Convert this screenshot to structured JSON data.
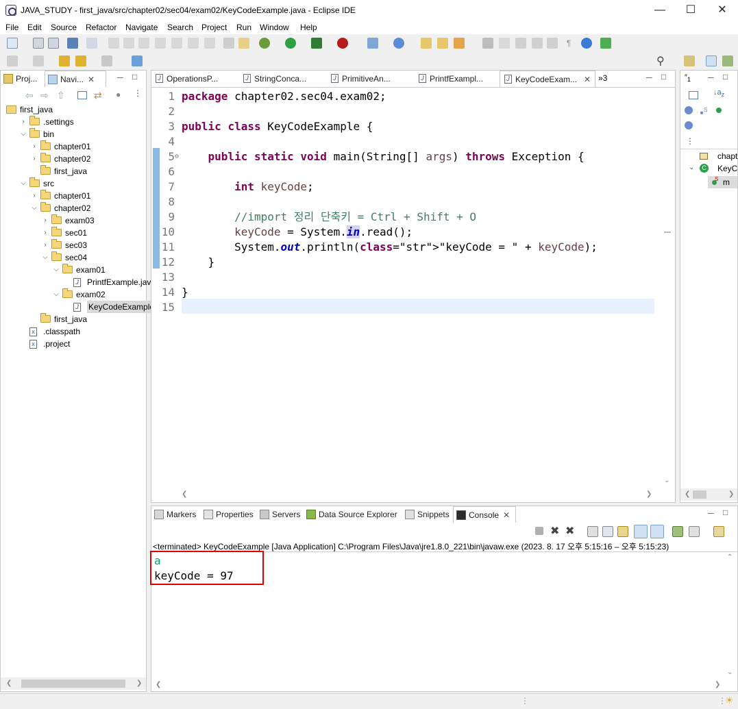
{
  "window": {
    "title": "JAVA_STUDY - first_java/src/chapter02/sec04/exam02/KeyCodeExample.java - Eclipse IDE"
  },
  "menu": [
    "File",
    "Edit",
    "Source",
    "Refactor",
    "Navigate",
    "Search",
    "Project",
    "Run",
    "Window",
    "Help"
  ],
  "left_tabs": [
    "Proj...",
    "Navi..."
  ],
  "tree": [
    {
      "label": "first_java",
      "depth": 0,
      "type": "project",
      "open": true
    },
    {
      "label": ".settings",
      "depth": 1,
      "type": "folder",
      "open": false
    },
    {
      "label": "bin",
      "depth": 1,
      "type": "folder",
      "open": true
    },
    {
      "label": "chapter01",
      "depth": 2,
      "type": "folder",
      "open": false
    },
    {
      "label": "chapter02",
      "depth": 2,
      "type": "folder",
      "open": false
    },
    {
      "label": "first_java",
      "depth": 2,
      "type": "folder",
      "open": null
    },
    {
      "label": "src",
      "depth": 1,
      "type": "folder",
      "open": true
    },
    {
      "label": "chapter01",
      "depth": 2,
      "type": "folder",
      "open": false
    },
    {
      "label": "chapter02",
      "depth": 2,
      "type": "folder",
      "open": true
    },
    {
      "label": "exam03",
      "depth": 3,
      "type": "folder",
      "open": false
    },
    {
      "label": "sec01",
      "depth": 3,
      "type": "folder",
      "open": false
    },
    {
      "label": "sec03",
      "depth": 3,
      "type": "folder",
      "open": false
    },
    {
      "label": "sec04",
      "depth": 3,
      "type": "folder",
      "open": true
    },
    {
      "label": "exam01",
      "depth": 4,
      "type": "folder",
      "open": true
    },
    {
      "label": "PrintfExample.java",
      "depth": 5,
      "type": "java",
      "open": null
    },
    {
      "label": "exam02",
      "depth": 4,
      "type": "folder",
      "open": true
    },
    {
      "label": "KeyCodeExample.java",
      "depth": 5,
      "type": "java",
      "open": null,
      "selected": true
    },
    {
      "label": "first_java",
      "depth": 2,
      "type": "folder",
      "open": null
    },
    {
      "label": ".classpath",
      "depth": 1,
      "type": "xml",
      "open": null
    },
    {
      "label": ".project",
      "depth": 1,
      "type": "xml",
      "open": null
    }
  ],
  "editor_tabs": [
    "OperationsP...",
    "StringConca...",
    "PrimitiveAn...",
    "PrintfExampl...",
    "KeyCodeExam..."
  ],
  "editor_more": "»3",
  "code_lines": [
    {
      "n": "1",
      "t": "package chapter02.sec04.exam02;"
    },
    {
      "n": "2",
      "t": ""
    },
    {
      "n": "3",
      "t": "public class KeyCodeExample {"
    },
    {
      "n": "4",
      "t": ""
    },
    {
      "n": "5",
      "t": "    public static void main(String[] args) throws Exception {"
    },
    {
      "n": "6",
      "t": ""
    },
    {
      "n": "7",
      "t": "        int keyCode;"
    },
    {
      "n": "8",
      "t": ""
    },
    {
      "n": "9",
      "t": "        //import 정리 단축키 = Ctrl + Shift + O"
    },
    {
      "n": "10",
      "t": "        keyCode = System.in.read();"
    },
    {
      "n": "11",
      "t": "        System.out.println(\"keyCode = \" + keyCode);"
    },
    {
      "n": "12",
      "t": "    }"
    },
    {
      "n": "13",
      "t": ""
    },
    {
      "n": "14",
      "t": "}"
    },
    {
      "n": "15",
      "t": ""
    }
  ],
  "outline": {
    "items": [
      "chapt",
      "KeyC",
      "m"
    ]
  },
  "bottom_tabs": [
    "Markers",
    "Properties",
    "Servers",
    "Data Source Explorer",
    "Snippets",
    "Console"
  ],
  "console": {
    "status": "<terminated> KeyCodeExample [Java Application] C:\\Program Files\\Java\\jre1.8.0_221\\bin\\javaw.exe  (2023. 8. 17 오후 5:15:16 – 오후 5:15:23)",
    "input": "a",
    "output": "keyCode = 97"
  },
  "colors": {
    "keyword": "#7f0055",
    "comment": "#3f7f5f",
    "string": "#2a00ff",
    "highlight_box": "#e00000",
    "console_input": "#00a36c"
  }
}
